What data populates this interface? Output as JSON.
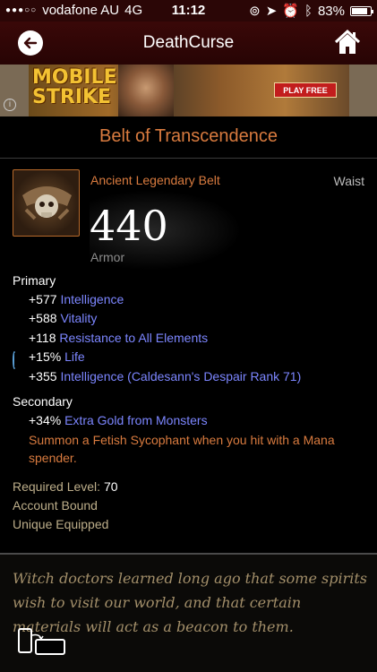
{
  "status": {
    "carrier": "vodafone AU",
    "network": "4G",
    "time": "11:12",
    "battery": "83%",
    "battery_level": 0.83
  },
  "nav": {
    "title": "DeathCurse"
  },
  "ad": {
    "brand": "MOBILE STRIKE",
    "cta": "PLAY FREE",
    "info": "i"
  },
  "item": {
    "name": "Belt of Transcendence",
    "type": "Ancient Legendary Belt",
    "slot": "Waist",
    "armor_value": "440",
    "armor_label": "Armor"
  },
  "primary": {
    "label": "Primary",
    "stats": [
      {
        "value": "+577 ",
        "name": "Intelligence",
        "bullet": "diamond"
      },
      {
        "value": "+588 ",
        "name": "Vitality",
        "bullet": "diamond"
      },
      {
        "value": "+118 ",
        "name": "Resistance to All Elements",
        "bullet": "diamond"
      },
      {
        "value": "+15% ",
        "name": "Life",
        "bullet": "swirl"
      },
      {
        "value": "+355 ",
        "name": "Intelligence (Caldesann's Despair Rank 71)",
        "bullet": "diamond"
      }
    ]
  },
  "secondary": {
    "label": "Secondary",
    "stats": [
      {
        "value": "+34% ",
        "name": "Extra Gold from Monsters",
        "bullet": "diamond-orange"
      }
    ],
    "legendary_power": "Summon a Fetish Sycophant when you hit with a Mana spender."
  },
  "requirements": {
    "level_label": "Required Level: ",
    "level_value": "70",
    "account_bound": "Account Bound",
    "unique_equipped": "Unique Equipped"
  },
  "flavor_text": "Witch doctors learned long ago that some spirits wish to visit our world, and that certain materials will act as a beacon to them.",
  "colors": {
    "legendary": "#d97b3f",
    "stat_name": "#7c86ff",
    "nav_bg": "#2b0606"
  }
}
